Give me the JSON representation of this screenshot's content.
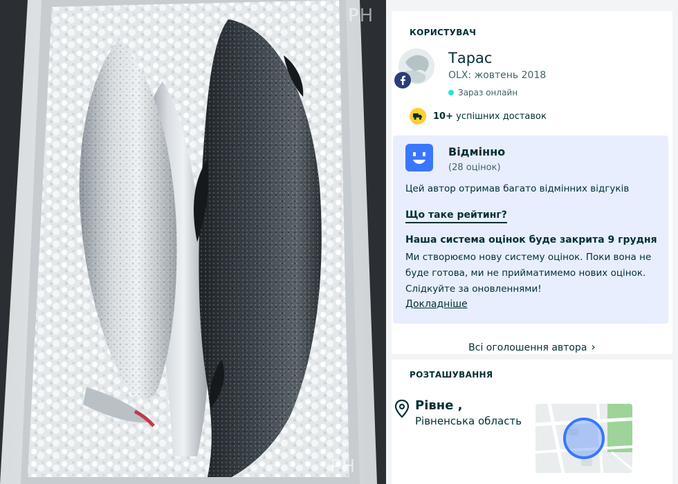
{
  "photo": {
    "alt": "",
    "watermark_top": "PH",
    "watermark_bottom": "PH"
  },
  "user_section": {
    "title": "КОРИСТУВАЧ",
    "name": "Тарас",
    "since": "OLX: жовтень 2018",
    "online_status": "Зараз онлайн",
    "deliveries": {
      "count": "10+",
      "label": "успішних доставок"
    },
    "avatar_badge_icon": "facebook-icon"
  },
  "rating": {
    "label": "Відмінно",
    "count": "(28 оцінок)",
    "description": "Цей автор отримав багато відмінних відгуків",
    "what_is_link": "Що таке рейтинг?",
    "notice_title": "Наша система оцінок буде закрита 9 грудня",
    "notice_text": "Ми створюємо нову систему оцінок. Поки вона не буде готова, ми не прийматимемо нових оцінок. Слідкуйте за оновленнями!",
    "more_link": "Докладніше"
  },
  "all_ads_link": "Всі оголошення автора",
  "location_section": {
    "title": "РОЗТАШУВАННЯ",
    "city": "Рівне ,",
    "region": "Рівненська область"
  },
  "colors": {
    "text": "#002f34",
    "rating_bg": "#e8eefe",
    "rating_face": "#3a77ff",
    "online_dot": "#23e5db",
    "delivery_badge": "#ffce32",
    "map_marker": "#3a77ff"
  }
}
